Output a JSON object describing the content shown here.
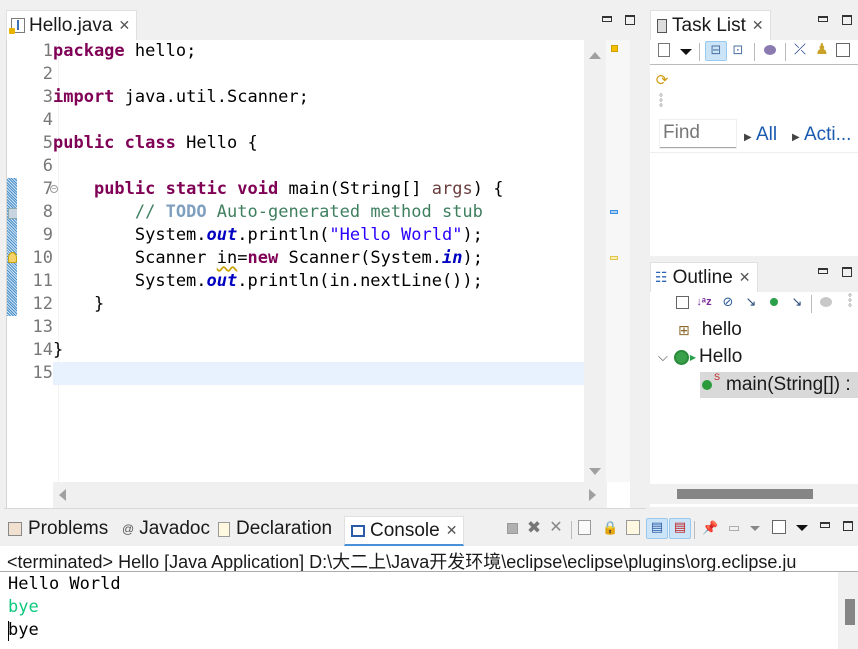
{
  "editor": {
    "tab": {
      "label": "Hello.java",
      "icon": "java-file-icon"
    },
    "lines": [
      {
        "n": "1",
        "html_tokens": [
          [
            "kw",
            "package"
          ],
          [
            "",
            "  hello;"
          ]
        ]
      },
      {
        "n": "2",
        "html_tokens": []
      },
      {
        "n": "3",
        "html_tokens": [
          [
            "kw",
            "import"
          ],
          [
            "",
            " java.util.Scanner;"
          ]
        ]
      },
      {
        "n": "4",
        "html_tokens": []
      },
      {
        "n": "5",
        "html_tokens": [
          [
            "kw",
            "public"
          ],
          [
            "",
            " "
          ],
          [
            "kw",
            "class"
          ],
          [
            "",
            " Hello {"
          ]
        ]
      },
      {
        "n": "6",
        "html_tokens": []
      },
      {
        "n": "7",
        "html_tokens": [
          [
            "",
            "    "
          ],
          [
            "kw",
            "public"
          ],
          [
            "",
            " "
          ],
          [
            "kw",
            "static"
          ],
          [
            "",
            " "
          ],
          [
            "kw",
            "void"
          ],
          [
            "",
            " main(String[] "
          ],
          [
            "arg",
            "args"
          ],
          [
            "",
            ") {"
          ]
        ]
      },
      {
        "n": "8",
        "html_tokens": [
          [
            "",
            "        "
          ],
          [
            "cm",
            "// "
          ],
          [
            "todo",
            "TODO"
          ],
          [
            "cm",
            " Auto-generated method stub"
          ]
        ]
      },
      {
        "n": "9",
        "html_tokens": [
          [
            "",
            "        System."
          ],
          [
            "fld",
            "out"
          ],
          [
            "",
            ".println("
          ],
          [
            "str",
            "\"Hello World\""
          ],
          [
            "",
            ");"
          ]
        ]
      },
      {
        "n": "10",
        "html_tokens": [
          [
            "",
            "        Scanner "
          ],
          [
            "warn",
            "in"
          ],
          [
            "",
            "="
          ],
          [
            "kw",
            "new"
          ],
          [
            "",
            " Scanner(System."
          ],
          [
            "fld",
            "in"
          ],
          [
            "",
            ");"
          ]
        ]
      },
      {
        "n": "11",
        "html_tokens": [
          [
            "",
            "        System."
          ],
          [
            "fld",
            "out"
          ],
          [
            "",
            ".println(in.nextLine());"
          ]
        ]
      },
      {
        "n": "12",
        "html_tokens": [
          [
            "",
            "    }"
          ]
        ]
      },
      {
        "n": "13",
        "html_tokens": []
      },
      {
        "n": "14",
        "html_tokens": [
          [
            "",
            "}"
          ]
        ]
      },
      {
        "n": "15",
        "html_tokens": []
      }
    ]
  },
  "tasklist": {
    "tab_label": "Task List",
    "find_placeholder": "Find",
    "filter_all": "All",
    "filter_activate": "Acti..."
  },
  "outline": {
    "tab_label": "Outline",
    "items": [
      {
        "label": "hello",
        "icon": "package-icon"
      },
      {
        "label": "Hello",
        "icon": "class-icon"
      },
      {
        "label": "main(String[]) :",
        "icon": "method-icon"
      }
    ]
  },
  "bottom": {
    "tabs": [
      {
        "label": "Problems",
        "icon": "problems-icon"
      },
      {
        "label": "Javadoc",
        "icon": "javadoc-icon"
      },
      {
        "label": "Declaration",
        "icon": "declaration-icon"
      },
      {
        "label": "Console",
        "icon": "console-icon",
        "active": true
      }
    ],
    "console_header": "<terminated> Hello [Java Application] D:\\大二上\\Java开发环境\\eclipse\\eclipse\\plugins\\org.eclipse.ju",
    "output": [
      {
        "text": "Hello World",
        "color": "#000000"
      },
      {
        "text": "bye",
        "color": "#0ec87e"
      },
      {
        "text": "bye",
        "color": "#000000"
      }
    ]
  },
  "colors": {
    "keyword": "#7f0055",
    "string": "#2a00ff",
    "comment": "#3f7f5f",
    "field": "#0000c0",
    "stdin": "#0ec87e",
    "current_line": "#e8f2fe"
  }
}
